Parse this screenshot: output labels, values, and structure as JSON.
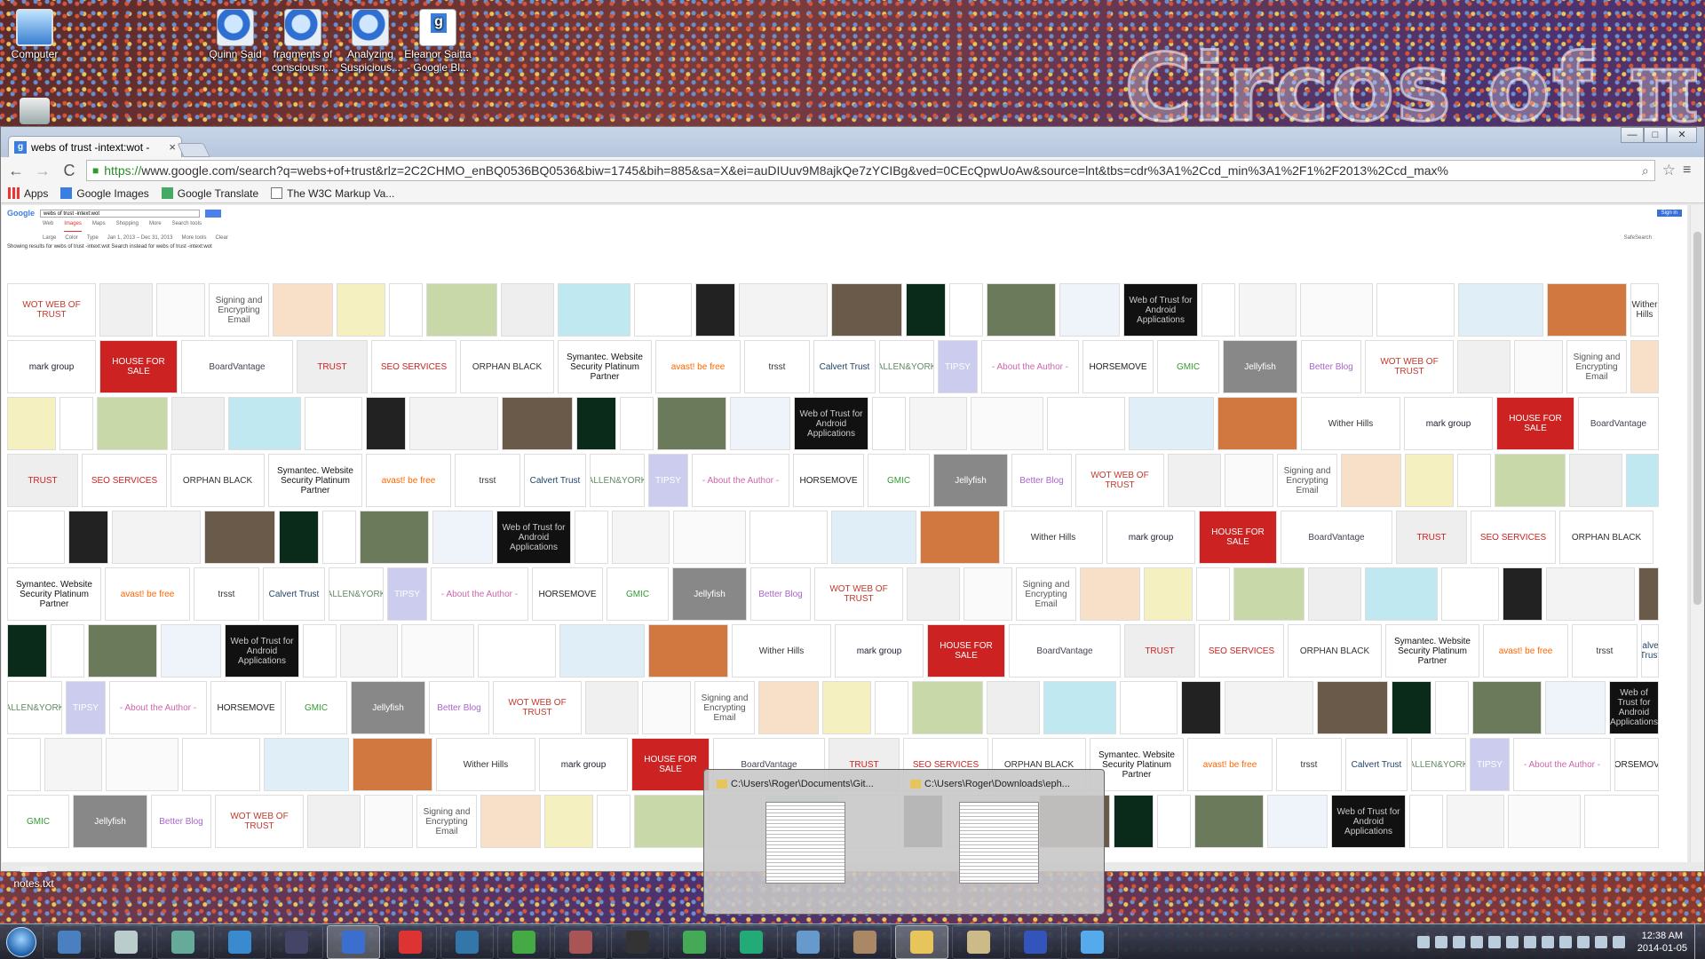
{
  "desktop": {
    "icons": [
      {
        "label": "Computer",
        "kind": "computer"
      },
      {
        "label": "Quinn Said",
        "kind": "shortcut"
      },
      {
        "label": "fragments of consciousn...",
        "kind": "shortcut"
      },
      {
        "label": "Analyzing Suspicious...",
        "kind": "shortcut"
      },
      {
        "label": "Eleanor Saitta - Google Bl...",
        "kind": "google"
      },
      {
        "label": "",
        "kind": "recycle-bin"
      },
      {
        "label": "notes.txt",
        "kind": "text-file"
      }
    ],
    "wallpaper_text": "Circos of π"
  },
  "browser": {
    "tab": {
      "title": "webs of trust -intext:wot -",
      "close": "×",
      "favicon": "g"
    },
    "window_buttons": {
      "minimize": "—",
      "maximize": "□",
      "close": "✕"
    },
    "nav": {
      "back": "←",
      "forward": "→",
      "reload": "C"
    },
    "address": {
      "scheme": "https://",
      "rest": "www.google.com/search?q=webs+of+trust&rlz=2C2CHMO_enBQ0536BQ0536&biw=1745&bih=885&sa=X&ei=auDIUuv9M8ajkQe7zYCIBg&ved=0CEcQpwUoAw&source=lnt&tbs=cdr%3A1%2Ccd_min%3A1%2F1%2F2013%2Ccd_max%"
    },
    "bookmarks": [
      {
        "label": "Apps",
        "icon": "apps-icon"
      },
      {
        "label": "Google Images",
        "icon": "google-icon"
      },
      {
        "label": "Google Translate",
        "icon": "translate-icon"
      },
      {
        "label": "The W3C Markup Va...",
        "icon": "document-icon"
      }
    ],
    "google": {
      "logo": "Google",
      "query": "webs of trust -intext:wot",
      "signin": "Sign in",
      "tabs": [
        "Web",
        "Images",
        "Maps",
        "Shopping",
        "More",
        "Search tools"
      ],
      "active_tab": "Images",
      "tools": [
        "Large",
        "Color",
        "Type",
        "Jan 1, 2013 – Dec 31, 2013",
        "More tools",
        "Clear"
      ],
      "results_note": "Showing results for webs of trust -intext:wot\nSearch instead for webs of trust -intext:wot",
      "safesearch": "SafeSearch"
    },
    "thumbnails": [
      {
        "label": "WOT WEB OF TRUST",
        "bg": "#ffffff",
        "fg": "#c0392b",
        "w": 100
      },
      {
        "label": "",
        "bg": "#f0f0f0",
        "fg": "#555",
        "w": 60
      },
      {
        "label": "",
        "bg": "#fafafa",
        "fg": "#555",
        "w": 55
      },
      {
        "label": "Signing and Encrypting Email",
        "bg": "#fff",
        "fg": "#555",
        "w": 68
      },
      {
        "label": "",
        "bg": "#f8e0c8",
        "fg": "#555",
        "w": 68
      },
      {
        "label": "",
        "bg": "#f5f0c0",
        "fg": "#555",
        "w": 55
      },
      {
        "label": "",
        "bg": "#fff",
        "fg": "#555",
        "w": 38
      },
      {
        "label": "",
        "bg": "#c9d8a8",
        "fg": "#555",
        "w": 80
      },
      {
        "label": "",
        "bg": "#eee",
        "fg": "#555",
        "w": 60
      },
      {
        "label": "",
        "bg": "#bfe8f0",
        "fg": "#c33",
        "w": 82
      },
      {
        "label": "",
        "bg": "#fff",
        "fg": "#555",
        "w": 65
      },
      {
        "label": "",
        "bg": "#222",
        "fg": "#aaa",
        "w": 45
      },
      {
        "label": "",
        "bg": "#f3f3f3",
        "fg": "#c33",
        "w": 100
      },
      {
        "label": "",
        "bg": "#6a5a4a",
        "fg": "#fff",
        "w": 80
      },
      {
        "label": "",
        "bg": "#0a2a1a",
        "fg": "#3f9",
        "w": 45
      },
      {
        "label": "",
        "bg": "#fff",
        "fg": "#555",
        "w": 38
      },
      {
        "label": "",
        "bg": "#6a7a5a",
        "fg": "#fff",
        "w": 78
      },
      {
        "label": "",
        "bg": "#eef4fa",
        "fg": "#555",
        "w": 68
      },
      {
        "label": "Web of Trust for Android Applications",
        "bg": "#111",
        "fg": "#ccc",
        "w": 84
      },
      {
        "label": "",
        "bg": "#fff",
        "fg": "#555",
        "w": 38
      },
      {
        "label": "",
        "bg": "#f5f5f5",
        "fg": "#555",
        "w": 65
      },
      {
        "label": "",
        "bg": "#fafafa",
        "fg": "#555",
        "w": 82
      },
      {
        "label": "",
        "bg": "#fff",
        "fg": "#555",
        "w": 88
      },
      {
        "label": "",
        "bg": "#e0eef8",
        "fg": "#555",
        "w": 96
      },
      {
        "label": "",
        "bg": "#d07840",
        "fg": "#fff",
        "w": 90
      },
      {
        "label": "Wither Hills",
        "bg": "#fff",
        "fg": "#333",
        "w": 112
      },
      {
        "label": "mark group",
        "bg": "#fff",
        "fg": "#223",
        "w": 100
      },
      {
        "label": "HOUSE FOR SALE",
        "bg": "#c22",
        "fg": "#fff",
        "w": 88
      },
      {
        "label": "BoardVantage",
        "bg": "#fff",
        "fg": "#445",
        "w": 126
      },
      {
        "label": "TRUST",
        "bg": "#eee",
        "fg": "#c22",
        "w": 80
      },
      {
        "label": "SEO SERVICES",
        "bg": "#fff",
        "fg": "#c22",
        "w": 96
      },
      {
        "label": "ORPHAN BLACK",
        "bg": "#fff",
        "fg": "#333",
        "w": 106
      },
      {
        "label": "Symantec. Website Security Platinum Partner",
        "bg": "#fff",
        "fg": "#111",
        "w": 106
      },
      {
        "label": "avast! be free",
        "bg": "#fff",
        "fg": "#f60",
        "w": 96
      },
      {
        "label": "trsst",
        "bg": "#fff",
        "fg": "#333",
        "w": 74
      },
      {
        "label": "Calvert Trust",
        "bg": "#fff",
        "fg": "#246",
        "w": 70
      },
      {
        "label": "ALLEN&YORK",
        "bg": "#fff",
        "fg": "#686",
        "w": 62
      },
      {
        "label": "TIPSY",
        "bg": "#cce",
        "fg": "#fff",
        "w": 45
      },
      {
        "label": "- About the Author -",
        "bg": "#fff",
        "fg": "#c6a",
        "w": 110
      },
      {
        "label": "HORSEMOVE",
        "bg": "#fff",
        "fg": "#222",
        "w": 80
      },
      {
        "label": "GMIC",
        "bg": "#fff",
        "fg": "#393",
        "w": 70
      },
      {
        "label": "Jellyfish",
        "bg": "#888",
        "fg": "#fff",
        "w": 84
      },
      {
        "label": "Better Blog",
        "bg": "#fff",
        "fg": "#a6c",
        "w": 68
      }
    ]
  },
  "preview": [
    {
      "title": "C:\\Users\\Roger\\Documents\\Git..."
    },
    {
      "title": "C:\\Users\\Roger\\Downloads\\eph..."
    }
  ],
  "taskbar": {
    "buttons": [
      {
        "name": "explorer",
        "color": "#4a7fc0"
      },
      {
        "name": "camera",
        "color": "#bcc"
      },
      {
        "name": "windows-media",
        "color": "#6a9"
      },
      {
        "name": "ie",
        "color": "#3a8ad0"
      },
      {
        "name": "keepass",
        "color": "#446"
      },
      {
        "name": "globe",
        "color": "#3a6fd0"
      },
      {
        "name": "chrome",
        "color": "#d33"
      },
      {
        "name": "thunderbird",
        "color": "#37a"
      },
      {
        "name": "spreadsheet",
        "color": "#4a4"
      },
      {
        "name": "editor",
        "color": "#a55"
      },
      {
        "name": "monitor",
        "color": "#333"
      },
      {
        "name": "python",
        "color": "#4a5"
      },
      {
        "name": "utorrent",
        "color": "#2a7"
      },
      {
        "name": "search-docs",
        "color": "#69c"
      },
      {
        "name": "gimp",
        "color": "#a86"
      },
      {
        "name": "folder",
        "color": "#e8c55a"
      },
      {
        "name": "tools",
        "color": "#cb8"
      },
      {
        "name": "info",
        "color": "#35b"
      },
      {
        "name": "app",
        "color": "#5ae"
      }
    ],
    "active": [
      "globe",
      "folder"
    ],
    "clock_time": "12:38 AM",
    "clock_date": "2014-01-05"
  }
}
